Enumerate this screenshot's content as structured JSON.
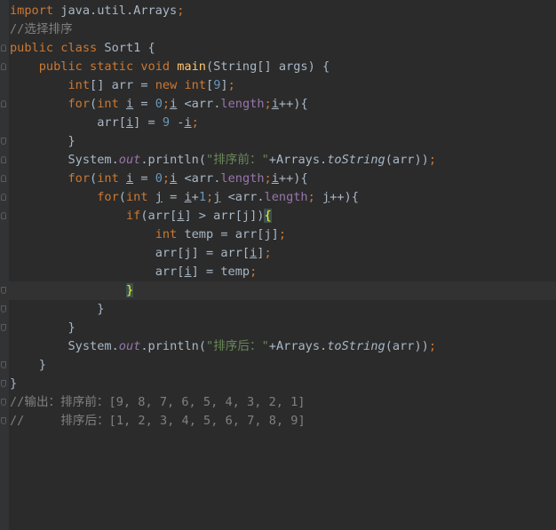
{
  "lines": [
    {
      "t": [
        [
          "import",
          "kw"
        ],
        [
          " java.util.Arrays",
          ""
        ],
        [
          ";",
          "punc"
        ]
      ]
    },
    {
      "t": [
        [
          "//选择排序",
          "cmt"
        ]
      ]
    },
    {
      "t": [
        [
          "public class ",
          "kw"
        ],
        [
          "Sort1 {",
          ""
        ]
      ]
    },
    {
      "t": [
        [
          "    ",
          ""
        ],
        [
          "public static void ",
          "kw"
        ],
        [
          "main",
          "fn"
        ],
        [
          "(String[] args) {",
          ""
        ]
      ]
    },
    {
      "t": [
        [
          "        ",
          ""
        ],
        [
          "int",
          "kw"
        ],
        [
          "[] arr = ",
          ""
        ],
        [
          "new int",
          "kw"
        ],
        [
          "[",
          ""
        ],
        [
          "9",
          "num"
        ],
        [
          "]",
          ""
        ],
        [
          ";",
          "punc"
        ]
      ]
    },
    {
      "t": [
        [
          "        ",
          ""
        ],
        [
          "for",
          "kw"
        ],
        [
          "(",
          ""
        ],
        [
          "int ",
          "kw"
        ],
        [
          "i",
          "ul"
        ],
        [
          " = ",
          ""
        ],
        [
          "0",
          "num"
        ],
        [
          ";",
          "punc"
        ],
        [
          "i",
          "ul"
        ],
        [
          " <arr.",
          ""
        ],
        [
          "length",
          "fld"
        ],
        [
          ";",
          "punc"
        ],
        [
          "i",
          "ul"
        ],
        [
          "++){",
          ""
        ]
      ]
    },
    {
      "t": [
        [
          "            ",
          ""
        ],
        [
          "arr[",
          ""
        ],
        [
          "i",
          "ul"
        ],
        [
          "] = ",
          ""
        ],
        [
          "9",
          "num"
        ],
        [
          " -",
          ""
        ],
        [
          "i",
          "ul"
        ],
        [
          ";",
          "punc"
        ]
      ]
    },
    {
      "t": [
        [
          "        ",
          ""
        ],
        [
          "}",
          ""
        ]
      ]
    },
    {
      "t": [
        [
          "        ",
          ""
        ],
        [
          "System.",
          ""
        ],
        [
          "out",
          "st"
        ],
        [
          ".println(",
          ""
        ],
        [
          "\"排序前：\"",
          "str"
        ],
        [
          "+Arrays.",
          ""
        ],
        [
          "toString",
          "sm"
        ],
        [
          "(arr))",
          ""
        ],
        [
          ";",
          "punc"
        ]
      ]
    },
    {
      "t": [
        [
          "        ",
          ""
        ],
        [
          "for",
          "kw"
        ],
        [
          "(",
          ""
        ],
        [
          "int ",
          "kw"
        ],
        [
          "i",
          "ul"
        ],
        [
          " = ",
          ""
        ],
        [
          "0",
          "num"
        ],
        [
          ";",
          "punc"
        ],
        [
          "i",
          "ul"
        ],
        [
          " <arr.",
          ""
        ],
        [
          "length",
          "fld"
        ],
        [
          ";",
          "punc"
        ],
        [
          "i",
          "ul"
        ],
        [
          "++){",
          ""
        ]
      ]
    },
    {
      "t": [
        [
          "            ",
          ""
        ],
        [
          "for",
          "kw"
        ],
        [
          "(",
          ""
        ],
        [
          "int ",
          "kw"
        ],
        [
          "j",
          "ul"
        ],
        [
          " = ",
          ""
        ],
        [
          "i",
          "ul"
        ],
        [
          "+",
          ""
        ],
        [
          "1",
          "num"
        ],
        [
          ";",
          "punc"
        ],
        [
          "j",
          "ul"
        ],
        [
          " <arr.",
          ""
        ],
        [
          "length",
          "fld"
        ],
        [
          "; ",
          "punc"
        ],
        [
          "j",
          "ul"
        ],
        [
          "++){",
          ""
        ]
      ]
    },
    {
      "t": [
        [
          "                ",
          ""
        ],
        [
          "if",
          "kw"
        ],
        [
          "(arr[",
          ""
        ],
        [
          "i",
          "ul"
        ],
        [
          "] > arr[j])",
          ""
        ],
        [
          "{",
          "hl"
        ]
      ]
    },
    {
      "t": [
        [
          "                    ",
          ""
        ],
        [
          "int ",
          "kw"
        ],
        [
          "temp = arr[j]",
          ""
        ],
        [
          ";",
          "punc"
        ]
      ]
    },
    {
      "t": [
        [
          "                    ",
          ""
        ],
        [
          "arr[j] = arr[",
          ""
        ],
        [
          "i",
          "ul"
        ],
        [
          "]",
          ""
        ],
        [
          ";",
          "punc"
        ]
      ]
    },
    {
      "t": [
        [
          "                    ",
          ""
        ],
        [
          "arr[",
          ""
        ],
        [
          "i",
          "ul"
        ],
        [
          "] = temp",
          ""
        ],
        [
          ";",
          "punc"
        ]
      ]
    },
    {
      "t": [
        [
          "                ",
          ""
        ],
        [
          "}",
          "hl"
        ]
      ],
      "caret": true
    },
    {
      "t": [
        [
          "            ",
          ""
        ],
        [
          "}",
          ""
        ]
      ]
    },
    {
      "t": [
        [
          "        ",
          ""
        ],
        [
          "}",
          ""
        ]
      ]
    },
    {
      "t": [
        [
          "        ",
          ""
        ],
        [
          "System.",
          ""
        ],
        [
          "out",
          "st"
        ],
        [
          ".println(",
          ""
        ],
        [
          "\"排序后：\"",
          "str"
        ],
        [
          "+Arrays.",
          ""
        ],
        [
          "toString",
          "sm"
        ],
        [
          "(arr))",
          ""
        ],
        [
          ";",
          "punc"
        ]
      ]
    },
    {
      "t": [
        [
          "    ",
          ""
        ],
        [
          "}",
          ""
        ]
      ]
    },
    {
      "t": [
        [
          "}",
          ""
        ]
      ]
    },
    {
      "t": [
        [
          "//输出：排序前：[9, 8, 7, 6, 5, 4, 3, 2, 1]",
          "cmt"
        ]
      ]
    },
    {
      "t": [
        [
          "//     排序后：[1, 2, 3, 4, 5, 6, 7, 8, 9]",
          "cmt"
        ]
      ]
    }
  ]
}
